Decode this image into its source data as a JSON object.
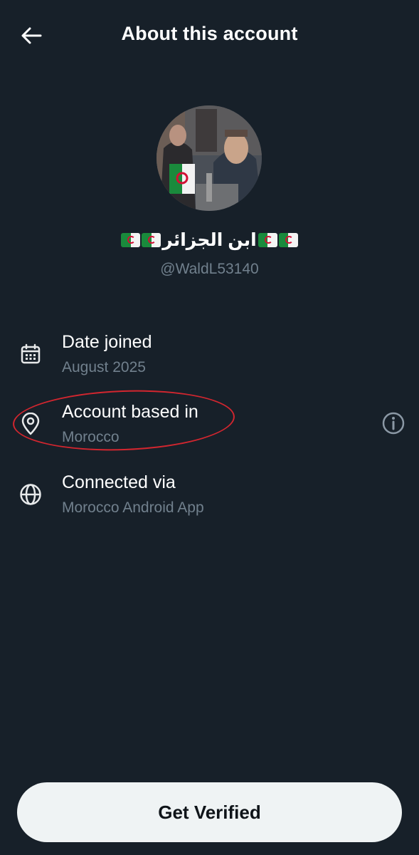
{
  "header": {
    "title": "About this account",
    "back_icon": "arrow-left-icon"
  },
  "profile": {
    "display_name_text": "ابن الجزائر",
    "flag_icon": "algeria-flag-icon",
    "handle": "@WaldL53140"
  },
  "details": [
    {
      "icon": "calendar-icon",
      "title": "Date joined",
      "value": "August 2025"
    },
    {
      "icon": "location-pin-icon",
      "title": "Account based in",
      "value": "Morocco"
    },
    {
      "icon": "globe-icon",
      "title": "Connected via",
      "value": "Morocco Android App"
    }
  ],
  "info_icon": "info-circle-icon",
  "footer": {
    "verify_label": "Get Verified"
  },
  "colors": {
    "background": "#172029",
    "primary_text": "#ffffff",
    "secondary_text": "#71808d",
    "button_bg": "#eff3f4",
    "highlight": "#d2262f"
  }
}
